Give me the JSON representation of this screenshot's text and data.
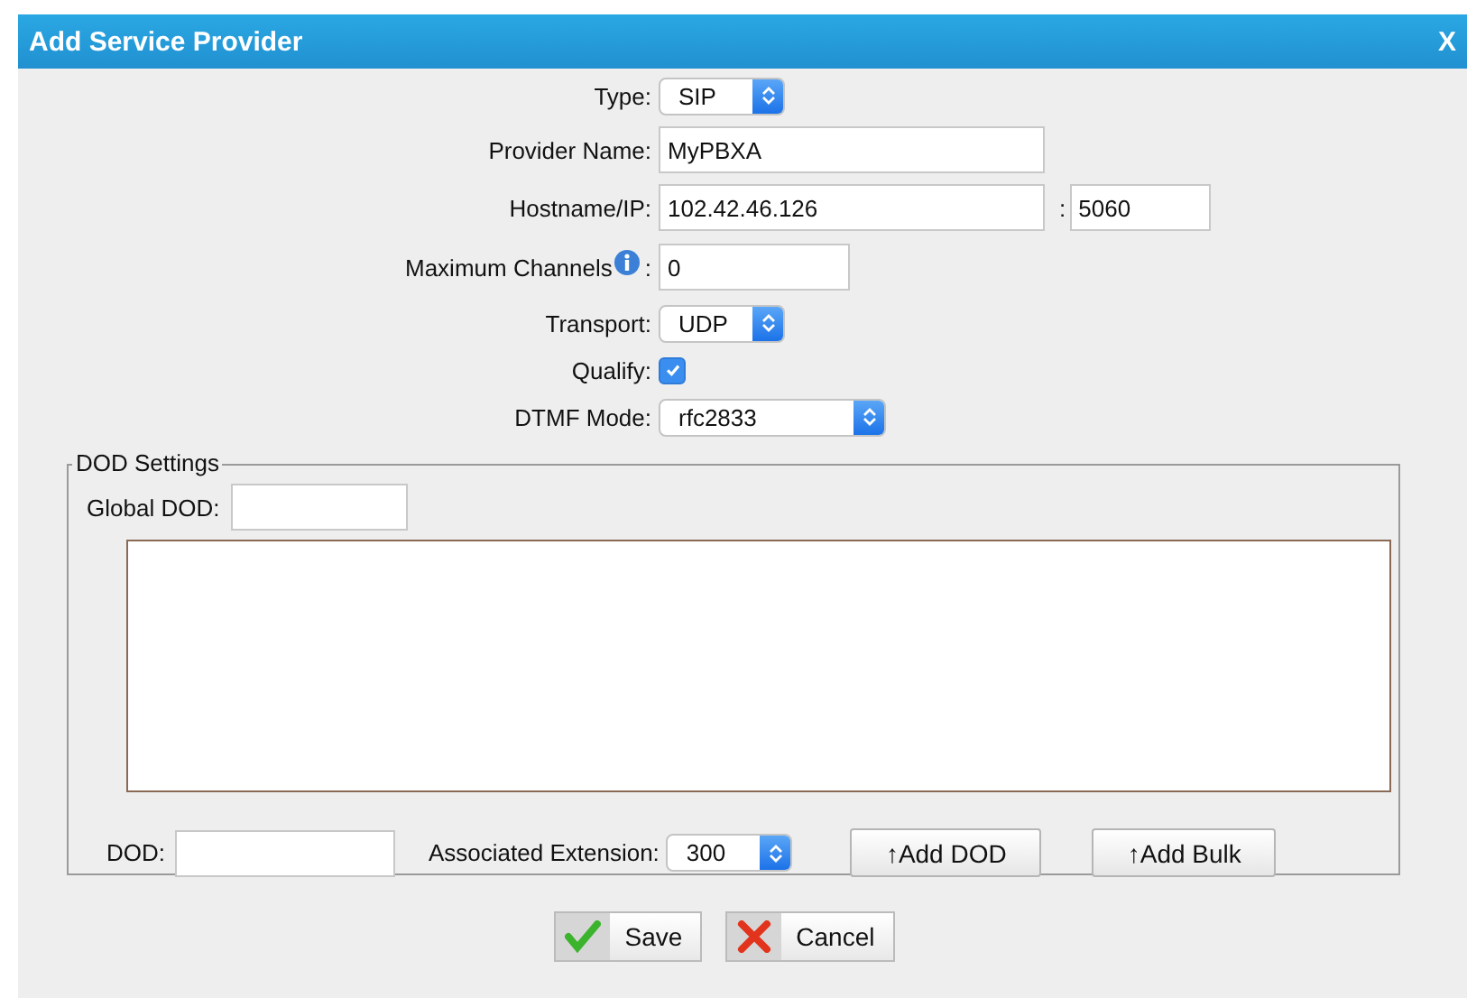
{
  "window": {
    "title": "Add Service Provider",
    "close": "X"
  },
  "fields": [
    {
      "kind": "select",
      "label": "Type:",
      "value": "SIP"
    },
    {
      "kind": "text",
      "label": "Provider Name:",
      "value": "MyPBXA"
    },
    {
      "kind": "host",
      "label": "Hostname/IP:",
      "value": "102.42.46.126",
      "separator": ":",
      "port": "5060"
    },
    {
      "kind": "info-text",
      "label": "Maximum Channels",
      "suffix": ":",
      "value": "0"
    },
    {
      "kind": "select",
      "label": "Transport:",
      "value": "UDP"
    },
    {
      "kind": "checkbox",
      "label": "Qualify:",
      "checked": true
    },
    {
      "kind": "select-wide",
      "label": "DTMF Mode:",
      "value": "rfc2833"
    }
  ],
  "dod_settings": {
    "legend": "DOD Settings",
    "global_dod_label": "Global DOD:",
    "dod_label": "DOD:",
    "extension_label": "Associated Extension:",
    "extension_value": "300",
    "add_dod_button": "↑Add DOD",
    "add_bulk_button": "↑Add Bulk"
  },
  "buttons": {
    "save": "Save",
    "cancel": "Cancel"
  }
}
